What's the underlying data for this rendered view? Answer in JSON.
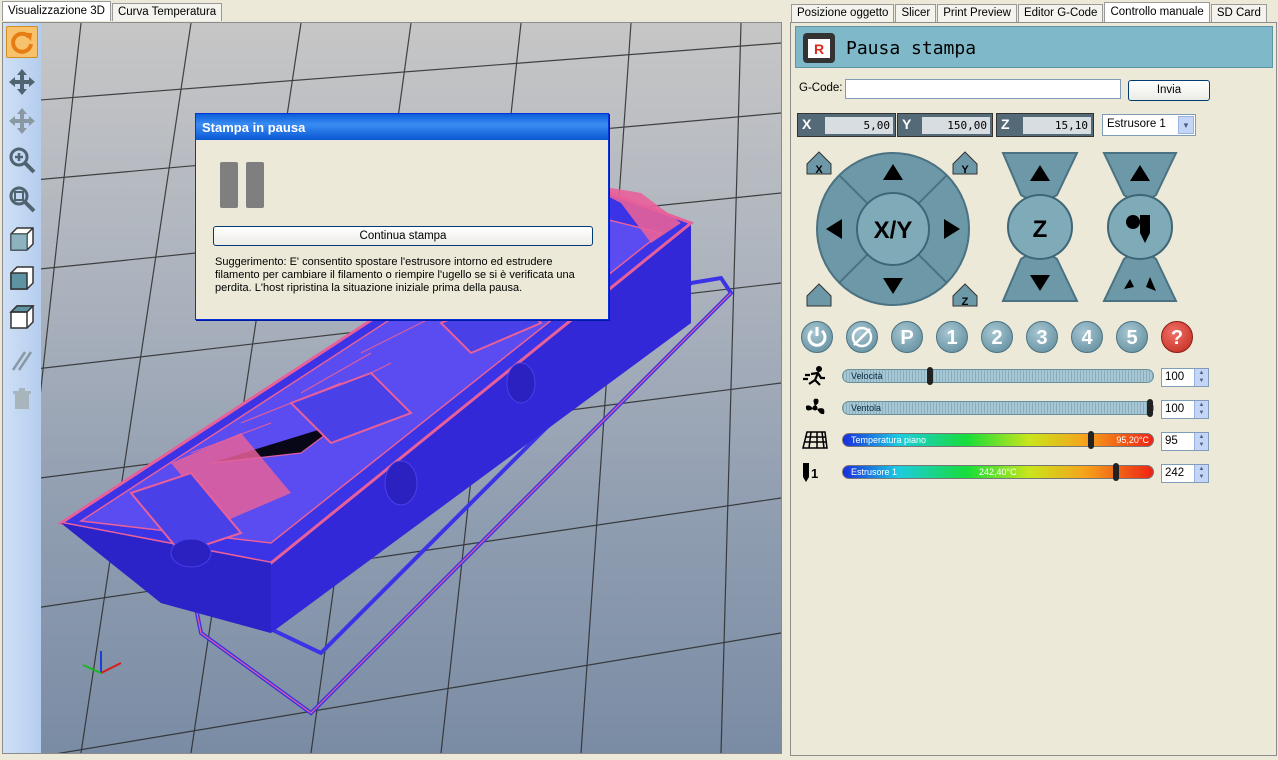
{
  "left_tabs": [
    "Visualizzazione 3D",
    "Curva Temperatura"
  ],
  "right_tabs": [
    "Posizione oggetto",
    "Slicer",
    "Print Preview",
    "Editor G-Code",
    "Controllo manuale",
    "SD Card"
  ],
  "toolbar_icons": [
    "rotate-icon",
    "move-icon",
    "pan-icon",
    "zoom-in-icon",
    "zoom-fit-icon",
    "view-iso-icon",
    "view-front-icon",
    "view-top-icon",
    "parallel-icon",
    "trash-icon"
  ],
  "dialog": {
    "title": "Stampa in pausa",
    "continue_label": "Continua stampa",
    "hint": "Suggerimento: E' consentito spostare l'estrusore intorno ed estrudere filamento per cambiare il filamento o riempire l'ugello se si è verificata una perdita. L'host ripristina la situazione iniziale prima della pausa."
  },
  "header": {
    "title": "Pausa stampa",
    "logo_letter": "R"
  },
  "gcode": {
    "label": "G-Code:",
    "value": "",
    "send_label": "Invia"
  },
  "coords": {
    "x_label": "X",
    "x": "5,00",
    "y_label": "Y",
    "y": "150,00",
    "z_label": "Z",
    "z": "15,10"
  },
  "extruder_select": "Estrusore 1",
  "jog": {
    "xy_label": "X/Y",
    "z_label": "Z",
    "home_x": "X",
    "home_y": "Y",
    "home_z": "Z"
  },
  "buttons": [
    "P",
    "1",
    "2",
    "3",
    "4",
    "5",
    "?"
  ],
  "sliders": {
    "speed": {
      "label": "Velocità",
      "value": "100",
      "level": 0.28
    },
    "fan": {
      "label": "Ventola",
      "value": "100",
      "level": 1.0
    },
    "bed": {
      "label": "Temperatura piano",
      "temp": "95,20°C",
      "value": "95",
      "level": 0.8
    },
    "extruder": {
      "label": "Estrusore 1",
      "temp": "242,40°C",
      "value": "242",
      "level": 0.88,
      "icon_num": "1"
    }
  },
  "colors": {
    "accent": "#f7c26b",
    "header": "#7fb9c9",
    "titlebar": "#0a5ed9",
    "part": "#3b33e6",
    "infill": "#e8609a"
  }
}
